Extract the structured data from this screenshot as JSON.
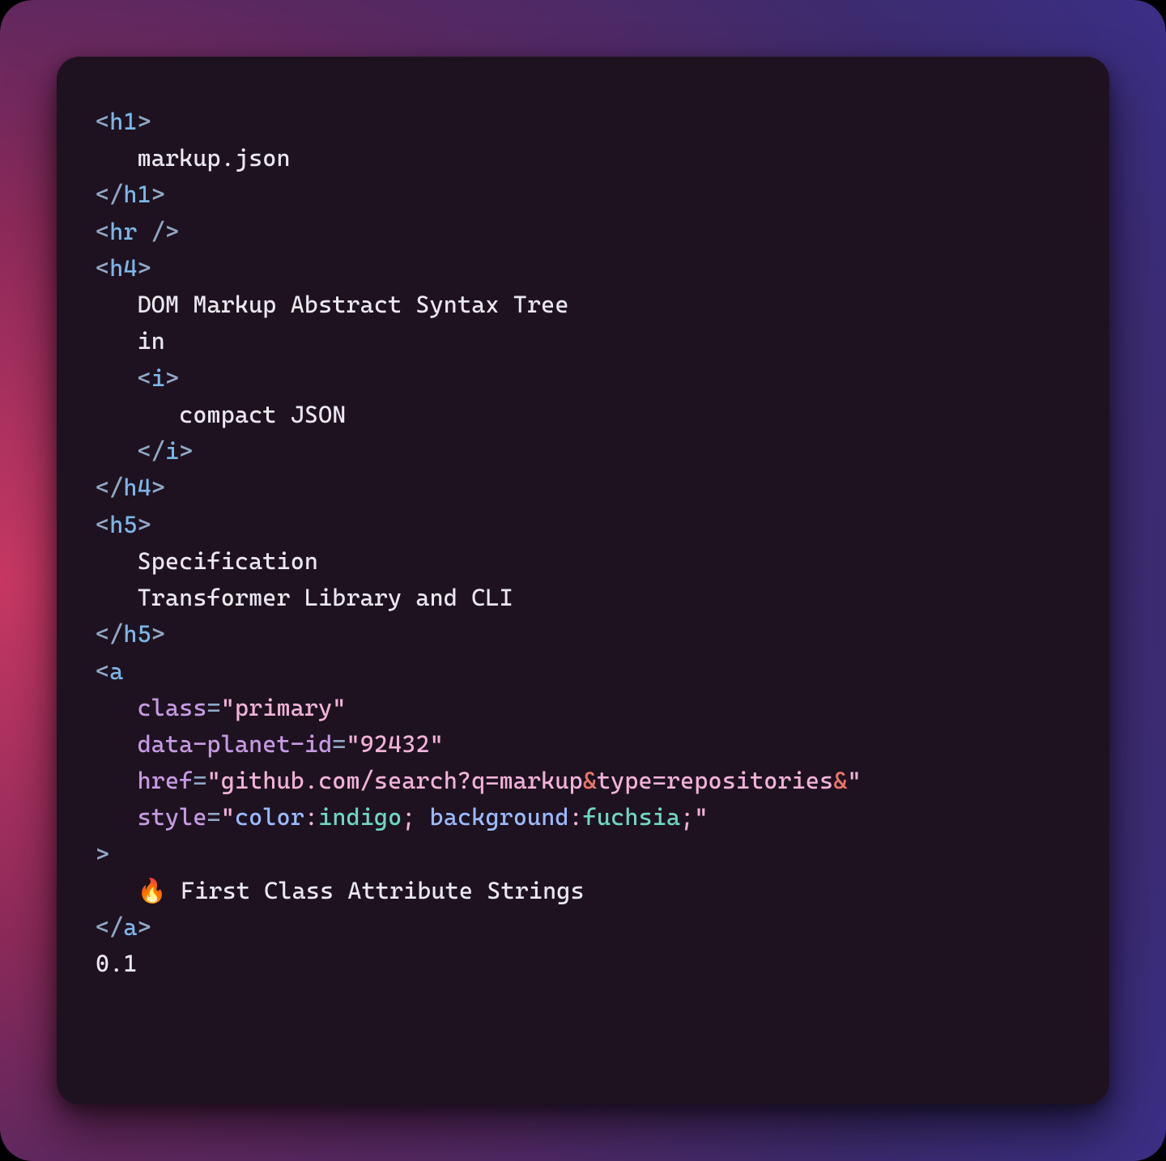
{
  "code": {
    "lines": [
      {
        "indent": 0,
        "tokens": [
          {
            "c": "p",
            "t": "<"
          },
          {
            "c": "tg",
            "t": "h1"
          },
          {
            "c": "p",
            "t": ">"
          }
        ]
      },
      {
        "indent": 1,
        "tokens": [
          {
            "c": "tx",
            "t": "markup.json"
          }
        ]
      },
      {
        "indent": 0,
        "tokens": [
          {
            "c": "p",
            "t": "</"
          },
          {
            "c": "tg",
            "t": "h1"
          },
          {
            "c": "p",
            "t": ">"
          }
        ]
      },
      {
        "indent": 0,
        "tokens": [
          {
            "c": "p",
            "t": "<"
          },
          {
            "c": "tg",
            "t": "hr"
          },
          {
            "c": "p",
            "t": " />"
          }
        ]
      },
      {
        "indent": 0,
        "tokens": [
          {
            "c": "p",
            "t": "<"
          },
          {
            "c": "tg",
            "t": "h4"
          },
          {
            "c": "p",
            "t": ">"
          }
        ]
      },
      {
        "indent": 1,
        "tokens": [
          {
            "c": "tx",
            "t": "DOM Markup Abstract Syntax Tree"
          }
        ]
      },
      {
        "indent": 1,
        "tokens": [
          {
            "c": "tx",
            "t": "in"
          }
        ]
      },
      {
        "indent": 1,
        "tokens": [
          {
            "c": "p",
            "t": "<"
          },
          {
            "c": "tg",
            "t": "i"
          },
          {
            "c": "p",
            "t": ">"
          }
        ]
      },
      {
        "indent": 2,
        "tokens": [
          {
            "c": "tx",
            "t": "compact JSON"
          }
        ]
      },
      {
        "indent": 1,
        "tokens": [
          {
            "c": "p",
            "t": "</"
          },
          {
            "c": "tg",
            "t": "i"
          },
          {
            "c": "p",
            "t": ">"
          }
        ]
      },
      {
        "indent": 0,
        "tokens": [
          {
            "c": "p",
            "t": "</"
          },
          {
            "c": "tg",
            "t": "h4"
          },
          {
            "c": "p",
            "t": ">"
          }
        ]
      },
      {
        "indent": 0,
        "tokens": [
          {
            "c": "p",
            "t": "<"
          },
          {
            "c": "tg",
            "t": "h5"
          },
          {
            "c": "p",
            "t": ">"
          }
        ]
      },
      {
        "indent": 1,
        "tokens": [
          {
            "c": "tx",
            "t": "Specification"
          }
        ]
      },
      {
        "indent": 1,
        "tokens": [
          {
            "c": "tx",
            "t": "Transformer Library and CLI"
          }
        ]
      },
      {
        "indent": 0,
        "tokens": [
          {
            "c": "p",
            "t": "</"
          },
          {
            "c": "tg",
            "t": "h5"
          },
          {
            "c": "p",
            "t": ">"
          }
        ]
      },
      {
        "indent": 0,
        "tokens": [
          {
            "c": "p",
            "t": "<"
          },
          {
            "c": "tg",
            "t": "a"
          }
        ]
      },
      {
        "indent": 1,
        "tokens": [
          {
            "c": "at",
            "t": "class"
          },
          {
            "c": "p",
            "t": "="
          },
          {
            "c": "st",
            "t": "\"primary\""
          }
        ]
      },
      {
        "indent": 1,
        "tokens": [
          {
            "c": "at",
            "t": "data-planet-id"
          },
          {
            "c": "p",
            "t": "="
          },
          {
            "c": "st",
            "t": "\"92432\""
          }
        ]
      },
      {
        "indent": 1,
        "tokens": [
          {
            "c": "at",
            "t": "href"
          },
          {
            "c": "p",
            "t": "="
          },
          {
            "c": "st",
            "t": "\""
          },
          {
            "c": "st",
            "t": "github.com/search?q=markup"
          },
          {
            "c": "am",
            "t": "&"
          },
          {
            "c": "st",
            "t": "type=repositories"
          },
          {
            "c": "am",
            "t": "&"
          },
          {
            "c": "st",
            "t": "\""
          }
        ]
      },
      {
        "indent": 1,
        "tokens": [
          {
            "c": "at",
            "t": "style"
          },
          {
            "c": "p",
            "t": "="
          },
          {
            "c": "st",
            "t": "\""
          },
          {
            "c": "kk",
            "t": "color"
          },
          {
            "c": "st",
            "t": ":"
          },
          {
            "c": "kv",
            "t": "indigo"
          },
          {
            "c": "st",
            "t": "; "
          },
          {
            "c": "kk",
            "t": "background"
          },
          {
            "c": "st",
            "t": ":"
          },
          {
            "c": "kv",
            "t": "fuchsia"
          },
          {
            "c": "st",
            "t": ";\""
          }
        ]
      },
      {
        "indent": 0,
        "tokens": [
          {
            "c": "p",
            "t": ">"
          }
        ]
      },
      {
        "indent": 1,
        "tokens": [
          {
            "c": "tx",
            "t": "🔥 First Class Attribute Strings"
          }
        ]
      },
      {
        "indent": 0,
        "tokens": [
          {
            "c": "p",
            "t": "</"
          },
          {
            "c": "tg",
            "t": "a"
          },
          {
            "c": "p",
            "t": ">"
          }
        ]
      },
      {
        "indent": 0,
        "tokens": [
          {
            "c": "nm",
            "t": "0.1"
          }
        ]
      }
    ],
    "indent_unit": "   "
  }
}
